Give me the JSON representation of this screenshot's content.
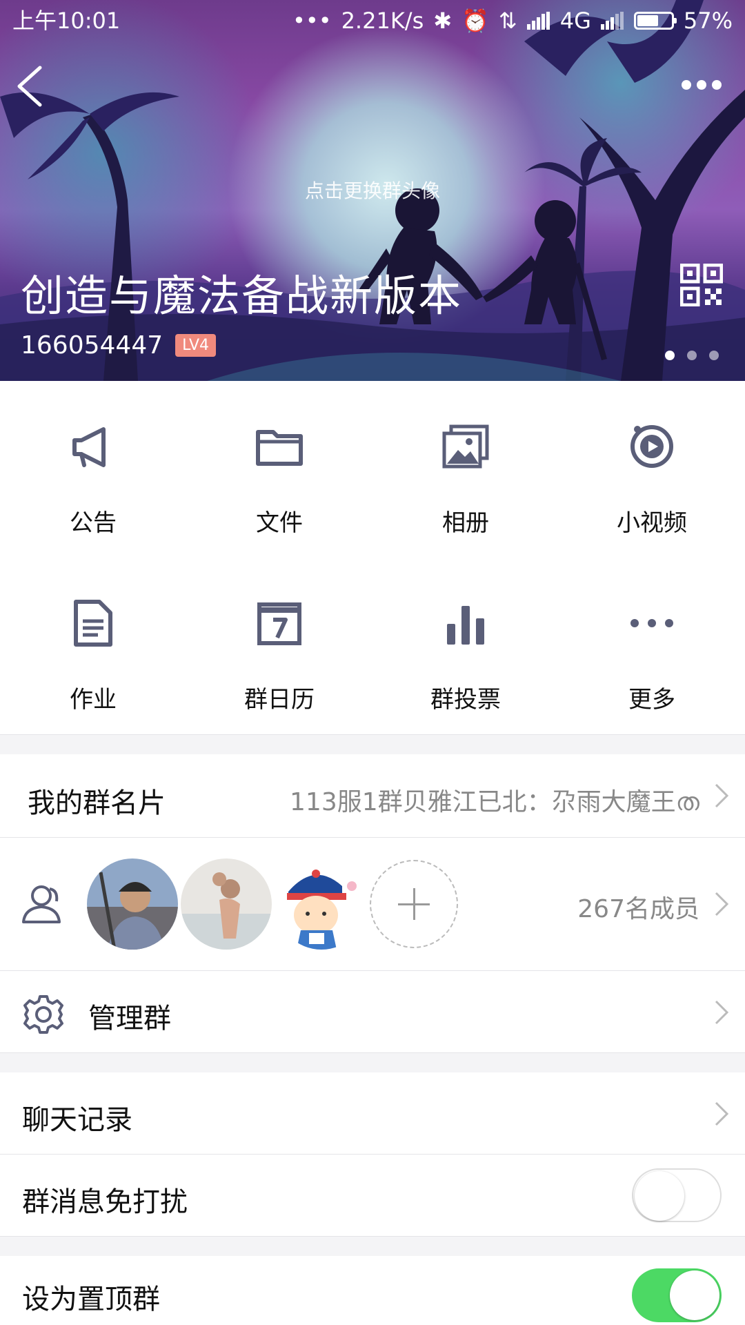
{
  "status_bar": {
    "time": "上午10:01",
    "network_speed": "2.21K/s",
    "network_type": "4G",
    "battery": "57%",
    "battery_level": 0.57
  },
  "header": {
    "change_avatar_hint": "点击更换群头像",
    "group_name": "创造与魔法备战新版本",
    "group_id": "166054447",
    "level": "LV4",
    "pager_count": 3,
    "pager_active": 0
  },
  "features": [
    {
      "label": "公告",
      "icon": "megaphone-icon"
    },
    {
      "label": "文件",
      "icon": "folder-icon"
    },
    {
      "label": "相册",
      "icon": "photo-album-icon"
    },
    {
      "label": "小视频",
      "icon": "video-play-icon"
    },
    {
      "label": "作业",
      "icon": "document-icon"
    },
    {
      "label": "群日历",
      "icon": "calendar-icon"
    },
    {
      "label": "群投票",
      "icon": "bar-chart-icon"
    },
    {
      "label": "更多",
      "icon": "more-dots-icon"
    }
  ],
  "group_card": {
    "label": "我的群名片",
    "value": "113服1群贝雅江已北：尕雨大魔王ത"
  },
  "members": {
    "count_label": "267名成员"
  },
  "manage": {
    "label": "管理群"
  },
  "chat_history": {
    "label": "聊天记录"
  },
  "mute": {
    "label": "群消息免打扰",
    "enabled": false
  },
  "pin_top": {
    "label": "设为置顶群",
    "enabled": true
  },
  "colors": {
    "icon_gray": "#5a5e78",
    "toggle_on": "#4cd964",
    "level_badge": "#f08a7d"
  }
}
